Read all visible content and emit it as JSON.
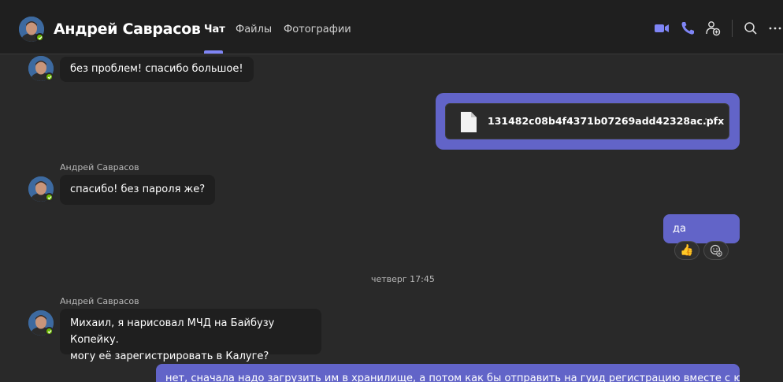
{
  "header": {
    "contact_name": "Андрей Саврасов",
    "tabs": [
      {
        "label": "Чат",
        "active": true
      },
      {
        "label": "Файлы",
        "active": false
      },
      {
        "label": "Фотографии",
        "active": false
      }
    ],
    "actions": [
      "video-call-icon",
      "audio-call-icon",
      "add-people-icon",
      "search-icon",
      "more-options-icon"
    ]
  },
  "messages": [
    {
      "from": "Андрей Саврасов",
      "text": "без проблем! спасибо большое!"
    },
    {
      "from": "me",
      "file_name": "131482c08b4f4371b07269add42328ac.pfx"
    },
    {
      "from": "Андрей Саврасов",
      "sender_label": "Андрей Саврасов",
      "text": "спасибо! без пароля же?"
    },
    {
      "from": "me",
      "text": "да",
      "reactions": [
        "👍"
      ]
    },
    {
      "separator": "четверг 17:45"
    },
    {
      "from": "Андрей Саврасов",
      "sender_label": "Андрей Саврасов",
      "lines": [
        "Михаил, я нарисовал МЧД на Байбузу Копейку.",
        "могу её зарегистрировать в Калуге?"
      ]
    },
    {
      "from": "me",
      "text": "нет, сначала надо загрузить им в хранилище, а потом как бы отправить на гуид регистрацию вместе с юзером"
    }
  ],
  "colors": {
    "accent": "#7f85f5",
    "outgoing": "#6264c8",
    "presence": "#6bb700"
  }
}
